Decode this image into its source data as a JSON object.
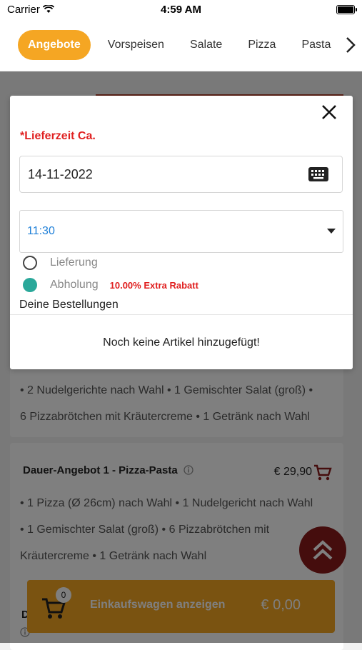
{
  "status_bar": {
    "carrier": "Carrier",
    "time": "4:59 AM"
  },
  "categories": {
    "items": [
      "Angebote",
      "Vorspeisen",
      "Salate",
      "Pizza",
      "Pasta"
    ],
    "active_index": 0
  },
  "background": {
    "offer1_lines": [
      "• 2 Nudelgerichte nach Wahl • 1 Gemischter Salat (groß) •",
      "6 Pizzabrötchen mit Kräutercreme • 1 Getränk nach Wahl"
    ],
    "offer2": {
      "title": "Dauer-Angebot 1 - Pizza-Pasta",
      "price": "€ 29,90",
      "lines": [
        "• 1 Pizza (Ø 26cm) nach Wahl • 1 Nudelgericht nach Wahl",
        "• 1 Gemischter Salat (groß) • 6 Pizzabrötchen mit",
        "Kräutercreme • 1 Getränk nach Wahl"
      ]
    },
    "offer3_title_initial": "D"
  },
  "cart_bar": {
    "count": "0",
    "label": "Einkaufswagen anzeigen",
    "total": "€ 0,00"
  },
  "modal": {
    "delivery_time_label": "*Lieferzeit Ca.",
    "date_value": "14-11-2022",
    "time_value": "11:30",
    "option_delivery": "Lieferung",
    "option_pickup": "Abholung",
    "selected_option": "Abholung",
    "pickup_discount": "10.00% Extra Rabatt",
    "orders_label": "Deine Bestellungen",
    "empty_message": "Noch keine Artikel hinzugefügt!"
  },
  "colors": {
    "accent": "#f5a623",
    "fab": "#8b1a1a",
    "alert_red": "#e02020",
    "radio_selected": "#2aa89a",
    "link_blue": "#1e7fd8"
  }
}
